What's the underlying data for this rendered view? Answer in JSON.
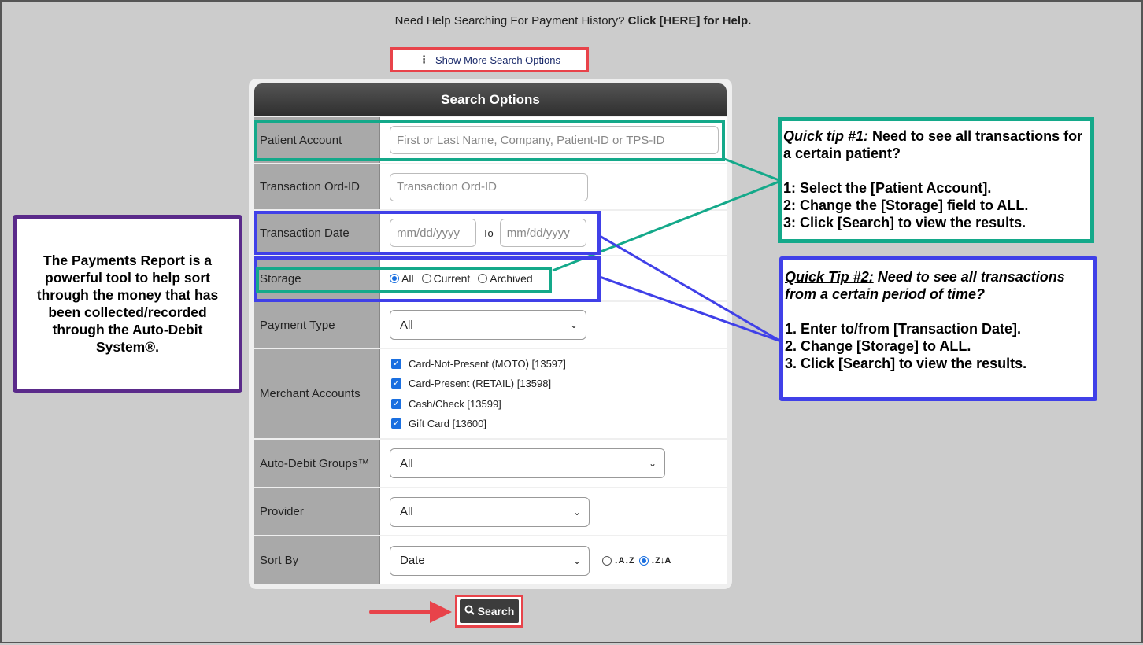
{
  "help": {
    "prefix": "Need Help Searching For Payment History?",
    "link": "Click [HERE] for Help."
  },
  "more_options": {
    "label": "Show More Search Options",
    "icon": "vertical-dots-icon"
  },
  "panel": {
    "title": "Search Options",
    "patient_account": {
      "label": "Patient Account",
      "placeholder": "First or Last Name, Company, Patient-ID or TPS-ID"
    },
    "ord_id": {
      "label": "Transaction Ord-ID",
      "placeholder": "Transaction Ord-ID"
    },
    "date": {
      "label": "Transaction Date",
      "from_placeholder": "mm/dd/yyyy",
      "to_label": "To",
      "to_placeholder": "mm/dd/yyyy"
    },
    "storage": {
      "label": "Storage",
      "options": [
        "All",
        "Current",
        "Archived"
      ],
      "selected": "All"
    },
    "payment_type": {
      "label": "Payment Type",
      "value": "All"
    },
    "merchant": {
      "label": "Merchant Accounts",
      "items": [
        {
          "label": "Card-Not-Present (MOTO) [13597]",
          "checked": true
        },
        {
          "label": "Card-Present (RETAIL) [13598]",
          "checked": true
        },
        {
          "label": "Cash/Check [13599]",
          "checked": true
        },
        {
          "label": "Gift Card [13600]",
          "checked": true
        }
      ]
    },
    "groups": {
      "label": "Auto-Debit Groups™",
      "value": "All"
    },
    "provider": {
      "label": "Provider",
      "value": "All"
    },
    "sort": {
      "label": "Sort By",
      "value": "Date",
      "asc_glyph": "↓A↓Z",
      "desc_glyph": "↓Z↓A",
      "selected": "desc"
    }
  },
  "search_button": {
    "label": "Search",
    "icon": "search-icon"
  },
  "callouts": {
    "intro": "The Payments Report is a powerful tool to help sort through the money that has been collected/recorded through the Auto-Debit System®.",
    "tip1": {
      "title": "Quick tip #1:",
      "title_rest": " Need to see all transactions for a certain patient?",
      "steps": [
        "1: Select the [Patient Account].",
        "2: Change the [Storage] field to ALL.",
        "3: Click [Search] to view the results."
      ]
    },
    "tip2": {
      "title": "Quick Tip #2:",
      "title_rest": " Need to see all transactions from a certain period of time?",
      "steps": [
        "1. Enter to/from [Transaction Date].",
        "2. Change [Storage] to ALL.",
        "3. Click [Search] to view the results."
      ]
    }
  },
  "colors": {
    "red": "#e8434a",
    "teal": "#14a98a",
    "blue": "#4040e8",
    "purple": "#5a2a8a",
    "header_dark": "#333333",
    "checkbox": "#1a6fe0"
  }
}
